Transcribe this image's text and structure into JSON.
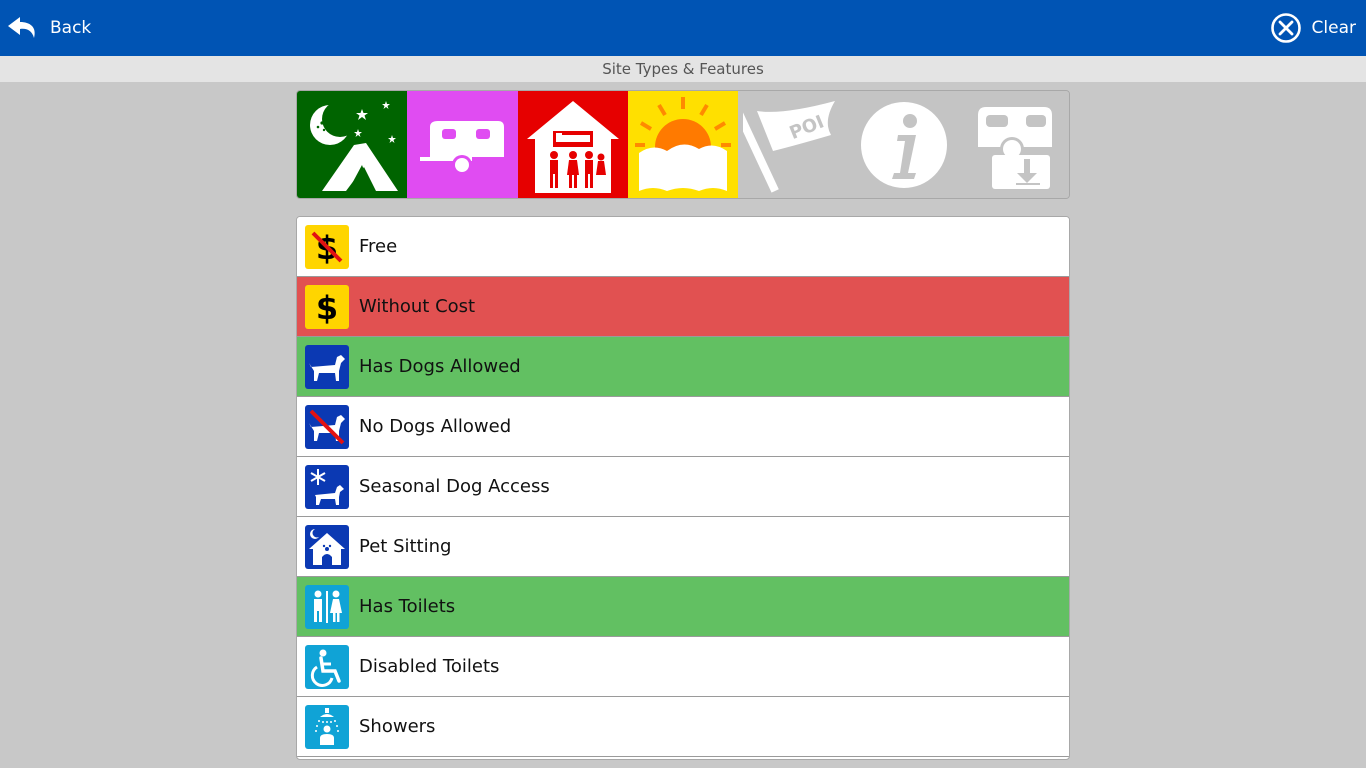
{
  "topbar": {
    "back_label": "Back",
    "clear_label": "Clear",
    "back_icon": "undo-arrow-icon",
    "clear_icon": "circle-x-icon"
  },
  "subheader": {
    "title": "Site Types & Features"
  },
  "site_types": [
    {
      "name": "camping",
      "icon": "tent-moon-icon",
      "color": "#006400",
      "selected": true
    },
    {
      "name": "caravan",
      "icon": "caravan-icon",
      "color": "#e04cf2",
      "selected": true
    },
    {
      "name": "accommodation",
      "icon": "house-bed-icon",
      "color": "#e60000",
      "selected": true
    },
    {
      "name": "day-use",
      "icon": "sun-icon",
      "color": "#ffe000",
      "selected": true
    },
    {
      "name": "points-of-interest",
      "icon": "poi-flag-icon",
      "color": "#c4c4c4",
      "selected": false,
      "text": "POI"
    },
    {
      "name": "information",
      "icon": "info-icon",
      "color": "#c4c4c4",
      "selected": false
    },
    {
      "name": "dump-point",
      "icon": "caravan-dump-icon",
      "color": "#c4c4c4",
      "selected": false
    }
  ],
  "features": [
    {
      "label": "Free",
      "icon": "no-dollar-icon",
      "state": "none"
    },
    {
      "label": "Without Cost",
      "icon": "dollar-icon",
      "state": "red"
    },
    {
      "label": "Has Dogs Allowed",
      "icon": "dog-icon",
      "state": "green"
    },
    {
      "label": "No Dogs Allowed",
      "icon": "no-dog-icon",
      "state": "none"
    },
    {
      "label": "Seasonal Dog Access",
      "icon": "snowflake-dog-icon",
      "state": "none"
    },
    {
      "label": "Pet Sitting",
      "icon": "dog-house-icon",
      "state": "none"
    },
    {
      "label": "Has Toilets",
      "icon": "toilets-icon",
      "state": "green"
    },
    {
      "label": "Disabled Toilets",
      "icon": "wheelchair-icon",
      "state": "none"
    },
    {
      "label": "Showers",
      "icon": "shower-icon",
      "state": "none"
    }
  ],
  "colors": {
    "topbar": "#0054b4",
    "background": "#c8c8c8",
    "exclude_red": "#e15151",
    "include_green": "#62c062",
    "icon_yellow": "#ffd500",
    "icon_blue": "#0b39b3",
    "icon_cyan": "#10a3d6"
  }
}
